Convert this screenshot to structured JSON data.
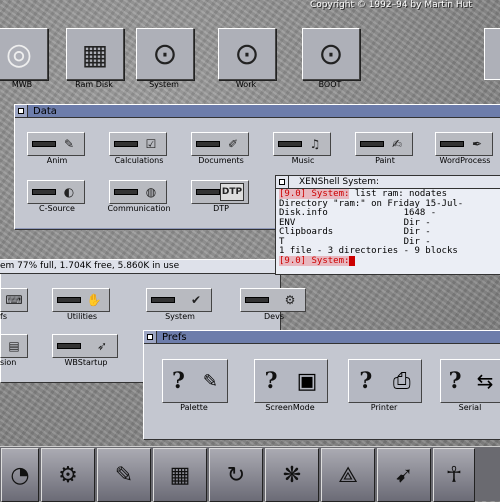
{
  "copyright": "Copyright © 1992–94 by Martin Hut",
  "desktop_icons": [
    {
      "label": "MWB",
      "icon": "cd-disk-icon",
      "glyph": "◎"
    },
    {
      "label": "Ram Disk",
      "icon": "ram-disk-icon",
      "glyph": "▦"
    },
    {
      "label": "System",
      "icon": "hard-drive-icon",
      "glyph": "⊙"
    },
    {
      "label": "Work",
      "icon": "hard-drive-icon",
      "glyph": "⊙"
    },
    {
      "label": "BOOT",
      "icon": "hard-drive-icon",
      "glyph": "⊙"
    }
  ],
  "data_window": {
    "title": "Data",
    "items": [
      {
        "label": "Anim",
        "icon": "anim-icon",
        "glyph": "✎"
      },
      {
        "label": "Calculations",
        "icon": "calculator-icon",
        "glyph": "☑"
      },
      {
        "label": "Documents",
        "icon": "documents-icon",
        "glyph": "✐"
      },
      {
        "label": "Music",
        "icon": "music-icon",
        "glyph": "♫"
      },
      {
        "label": "Paint",
        "icon": "paint-icon",
        "glyph": "✍"
      },
      {
        "label": "WordProcess",
        "icon": "wordprocess-icon",
        "glyph": "✒"
      },
      {
        "label": "C-Source",
        "icon": "c-source-icon",
        "glyph": "◐"
      },
      {
        "label": "Communication",
        "icon": "globe-icon",
        "glyph": "◍"
      },
      {
        "label": "DTP",
        "icon": "dtp-icon",
        "glyph": "DTP"
      }
    ]
  },
  "status_bar": {
    "text": "em 77% full, 1.704K free, 5.860K in use"
  },
  "sys_window": {
    "items": [
      {
        "label": "fs",
        "icon": "keyboard-icon",
        "glyph": "⌨"
      },
      {
        "label": "Utilities",
        "icon": "utilities-icon",
        "glyph": "✋"
      },
      {
        "label": "System",
        "icon": "system-icon",
        "glyph": "✔"
      },
      {
        "label": "Devs",
        "icon": "devs-icon",
        "glyph": "⚙"
      },
      {
        "label": "sion",
        "icon": "expansion-icon",
        "glyph": "▤"
      },
      {
        "label": "WBStartup",
        "icon": "wbstartup-icon",
        "glyph": "➶"
      }
    ]
  },
  "shell": {
    "title": "XENShell System:",
    "lines": [
      "Directory \"ram:\" on Friday 15-Jul-",
      "Disk.info              1648 -",
      "ENV                    Dir -",
      "Clipboards             Dir -",
      "T                      Dir -",
      "1 file - 3 directories - 9 blocks"
    ],
    "prompt1": "[9.0] System:",
    "command": " list ram: nodates",
    "prompt2": "[9.0] System:"
  },
  "prefs_window": {
    "title": "Prefs",
    "items": [
      {
        "label": "Palette",
        "icon": "palette-icon",
        "glyph": "✎"
      },
      {
        "label": "ScreenMode",
        "icon": "screenmode-icon",
        "glyph": "▣"
      },
      {
        "label": "Printer",
        "icon": "printer-icon",
        "glyph": "⎙"
      },
      {
        "label": "Serial",
        "icon": "serial-icon",
        "glyph": "⇆"
      }
    ]
  },
  "dock": [
    {
      "icon": "disk-icon",
      "glyph": "◔"
    },
    {
      "icon": "gears-icon",
      "glyph": "⚙"
    },
    {
      "icon": "editor-icon",
      "glyph": "✎"
    },
    {
      "icon": "disk-copy-icon",
      "glyph": "▦"
    },
    {
      "icon": "reload-icon",
      "glyph": "↻"
    },
    {
      "icon": "fractal-icon",
      "glyph": "❋"
    },
    {
      "icon": "drawing-tool-icon",
      "glyph": "⟁"
    },
    {
      "icon": "rocket-icon",
      "glyph": "➹"
    },
    {
      "icon": "tutankhamun-icon",
      "glyph": "☥"
    }
  ]
}
